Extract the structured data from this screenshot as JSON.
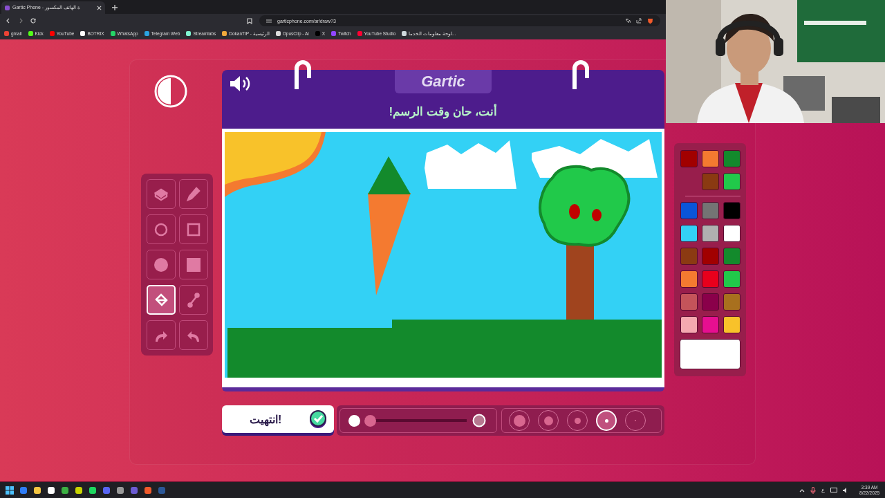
{
  "browser": {
    "tab": {
      "title": "Gartic Phone - ة الهاتف المكسور"
    },
    "url": "garticphone.com/ar/draw?3",
    "bookmarks": [
      {
        "label": "gmail",
        "color": "#ea4335"
      },
      {
        "label": "Kick",
        "color": "#53fc18"
      },
      {
        "label": "YouTube",
        "color": "#ff0000"
      },
      {
        "label": "BOTRIX",
        "color": "#ffffff"
      },
      {
        "label": "WhatsApp",
        "color": "#25d366"
      },
      {
        "label": "Telegram Web",
        "color": "#2aa3e0"
      },
      {
        "label": "Streamlabs",
        "color": "#80f5d2"
      },
      {
        "label": "DokanTIP - الرئيسية",
        "color": "#f2a93b"
      },
      {
        "label": "OpusClip - Ai",
        "color": "#dddddd"
      },
      {
        "label": "X",
        "color": "#000000"
      },
      {
        "label": "Twitch",
        "color": "#9146ff"
      },
      {
        "label": "YouTube Studio",
        "color": "#ff0033"
      },
      {
        "label": "لوحة معلومات الخدما...",
        "color": "#cfd8dc"
      }
    ]
  },
  "game": {
    "logo": "Gartic",
    "heading": "أنت، حان وقت الرسم!",
    "done_button": "انتهيت!",
    "tools": [
      {
        "kind": "eraser",
        "selected": false
      },
      {
        "kind": "pencil",
        "selected": false
      },
      {
        "kind": "circle-outline",
        "selected": false
      },
      {
        "kind": "square-outline",
        "selected": false
      },
      {
        "kind": "circle-filled",
        "selected": false
      },
      {
        "kind": "square-filled",
        "selected": false
      },
      {
        "kind": "bucket",
        "selected": true
      },
      {
        "kind": "line",
        "selected": false
      },
      {
        "kind": "redo",
        "selected": false
      },
      {
        "kind": "undo",
        "selected": false
      }
    ],
    "palette": {
      "recent": [
        {
          "color": "#138a2c"
        },
        {
          "color": "#f47a30"
        },
        {
          "color": "#a10000"
        },
        {
          "color": "#21c94a"
        },
        {
          "color": "#8a3a12"
        }
      ],
      "colors": [
        {
          "color": "#0a55d8"
        },
        {
          "color": "#747474"
        },
        {
          "color": "#000000"
        },
        {
          "color": "#33d1f5"
        },
        {
          "color": "#b0b0b0"
        },
        {
          "color": "#ffffff"
        },
        {
          "color": "#8b3a12"
        },
        {
          "color": "#a10000"
        },
        {
          "color": "#138a2c"
        },
        {
          "color": "#f47a30"
        },
        {
          "color": "#e8001c"
        },
        {
          "color": "#21c94a"
        },
        {
          "color": "#c4545a"
        },
        {
          "color": "#8a004a"
        },
        {
          "color": "#a8701e"
        },
        {
          "color": "#f4a8b0"
        },
        {
          "color": "#e60f90"
        },
        {
          "color": "#f8c22a"
        }
      ],
      "current": {
        "color": "#ffffff"
      }
    },
    "opacity": {
      "level": 0
    },
    "brush_sizes": [
      {
        "selected": false
      },
      {
        "selected": false
      },
      {
        "selected": false
      },
      {
        "selected": true
      },
      {
        "selected": false
      }
    ]
  },
  "taskbar": {
    "language": "ع",
    "time": "3:39 AM",
    "date": "8/22/2025"
  }
}
